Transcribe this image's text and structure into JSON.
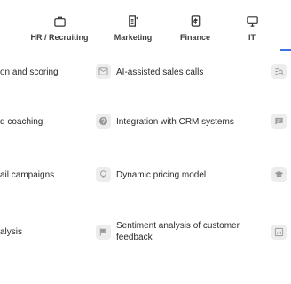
{
  "tabs": [
    {
      "label": "HR / Recruiting",
      "icon": "briefcase-icon"
    },
    {
      "label": "Marketing",
      "icon": "document-sparkle-icon"
    },
    {
      "label": "Finance",
      "icon": "receipt-icon"
    },
    {
      "label": "IT",
      "icon": "monitor-icon"
    }
  ],
  "rows": [
    {
      "left": "on and scoring",
      "middle": "AI-assisted sales calls",
      "middle_icon": "mail-chart-icon",
      "right_icon": "search-list-icon"
    },
    {
      "left": "d coaching",
      "middle": "Integration with CRM systems",
      "middle_icon": "question-circle-icon",
      "right_icon": "chat-bubble-icon"
    },
    {
      "left": "ail campaigns",
      "middle": "Dynamic pricing model",
      "middle_icon": "lightbulb-icon",
      "right_icon": "graduation-cap-icon"
    },
    {
      "left": "alysis",
      "middle": "Sentiment analysis of customer feedback",
      "middle_icon": "flag-icon",
      "right_icon": "bar-chart-icon"
    }
  ],
  "colors": {
    "accent": "#3b73e6",
    "icon_bg": "#ededed",
    "icon_fg": "#9a9a9a"
  }
}
